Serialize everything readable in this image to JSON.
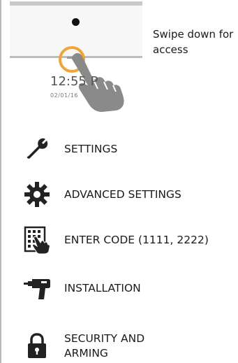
{
  "device": {
    "clock_time": "12:55 P",
    "clock_date": "02/01/16"
  },
  "swipe_caption": "Swipe down for access",
  "menu": [
    {
      "label": "SETTINGS",
      "icon": "wrench-icon"
    },
    {
      "label": "ADVANCED SETTINGS",
      "icon": "gear-icon"
    },
    {
      "label": "ENTER CODE (1111, 2222)",
      "icon": "keypad-hand-icon"
    },
    {
      "label": "INSTALLATION",
      "icon": "drill-icon"
    },
    {
      "label": "SECURITY AND ARMING",
      "icon": "padlock-icon"
    }
  ],
  "colors": {
    "accent": "#f0a53a",
    "icon": "#222222",
    "hand": "#8a8a8a"
  }
}
